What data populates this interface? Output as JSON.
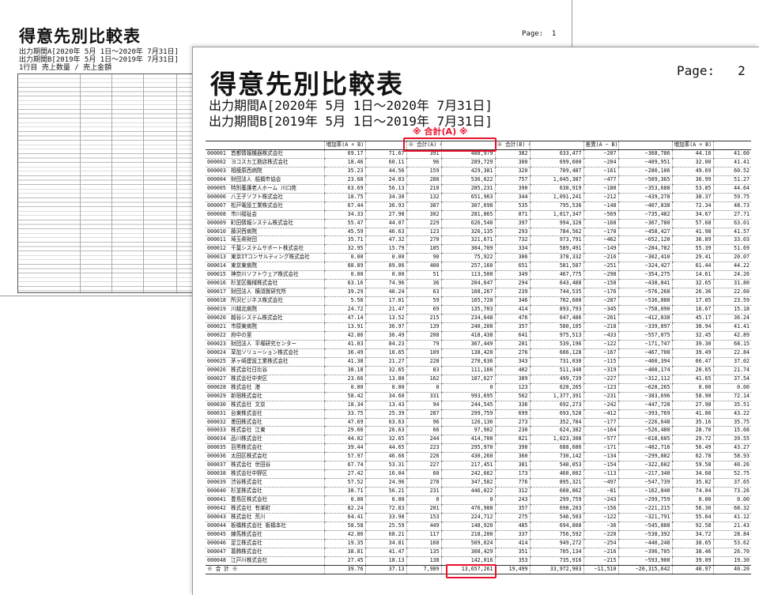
{
  "accent_color": "#e8102a",
  "page1": {
    "title": "得意先別比較表",
    "period_a": "出力期間A[2020年 5月 1日～2020年 7月31日]",
    "period_b": "出力期間B[2019年 5月 1日～2019年 7月31日]",
    "row_desc": "1行目 売上数量 / 売上金額",
    "page_label": "Page:  1"
  },
  "page2": {
    "title": "得意先別比較表",
    "page_label": "Page:   2",
    "period_a": "出力期間A[2020年 5月 1日～2020年 7月31日]",
    "period_b": "出力期間B[2019年 5月 1日～2019年 7月31日]",
    "annotation": "※ 合計(A) ※",
    "headers": [
      "",
      "増加率(A ÷ B)",
      "",
      "※ 合計(A) ※",
      "",
      "※ 合計(B) ※",
      "",
      "差異(A − B)",
      "",
      "増加率(A ÷ B)",
      ""
    ],
    "rows": [
      [
        "000001",
        "首都情報機器株式会社",
        "69.17",
        "71.67",
        "391",
        "488,979",
        "382",
        "633,477",
        "−207",
        "−368,786",
        "44.16",
        "41.60"
      ],
      [
        "000002",
        "ヨコスカ工務店株式会社",
        "18.46",
        "60.11",
        "96",
        "289,729",
        "300",
        "699,600",
        "−204",
        "−409,951",
        "32.00",
        "41.41"
      ],
      [
        "000003",
        "相模原西病院",
        "35.23",
        "44.56",
        "159",
        "429,381",
        "320",
        "709,487",
        "−161",
        "−280,106",
        "49.69",
        "60.52"
      ],
      [
        "000004",
        "財団法人 船橋市協会",
        "23.68",
        "24.03",
        "280",
        "536,022",
        "757",
        "1,045,387",
        "−477",
        "−509,365",
        "36.99",
        "51.27"
      ],
      [
        "000005",
        "特別養護老人ホーム 川口苑",
        "63.69",
        "56.13",
        "210",
        "285,231",
        "390",
        "638,919",
        "−180",
        "−353,688",
        "53.85",
        "44.64"
      ],
      [
        "000006",
        "八王子ソフト株式会社",
        "18.75",
        "34.30",
        "132",
        "651,963",
        "344",
        "1,091,241",
        "−212",
        "−439,278",
        "38.37",
        "59.75"
      ],
      [
        "000007",
        "松戸電設工業株式会社",
        "67.44",
        "36.93",
        "387",
        "307,698",
        "535",
        "795,536",
        "−148",
        "−407,838",
        "72.34",
        "48.73"
      ],
      [
        "000008",
        "市川福祉会",
        "34.33",
        "27.98",
        "302",
        "281,865",
        "871",
        "1,017,347",
        "−569",
        "−735,482",
        "34.67",
        "27.71"
      ],
      [
        "000009",
        "町田情報システム株式会社",
        "55.47",
        "44.07",
        "229",
        "626,540",
        "397",
        "994,320",
        "−168",
        "−367,780",
        "57.68",
        "63.01"
      ],
      [
        "000010",
        "藤沢西病院",
        "45.59",
        "46.63",
        "123",
        "326,135",
        "293",
        "784,562",
        "−170",
        "−458,427",
        "41.98",
        "41.57"
      ],
      [
        "000011",
        "埼玉県財団",
        "35.71",
        "47.32",
        "270",
        "321,671",
        "732",
        "973,791",
        "−462",
        "−652,120",
        "36.89",
        "33.03"
      ],
      [
        "000012",
        "千葉システムサポート株式会社",
        "32.95",
        "15.79",
        "185",
        "304,709",
        "334",
        "589,491",
        "−149",
        "−284,782",
        "55.39",
        "51.69"
      ],
      [
        "000013",
        "東京ITコンサルティング株式会社",
        "0.00",
        "0.00",
        "90",
        "75,922",
        "306",
        "378,332",
        "−216",
        "−302,410",
        "29.41",
        "20.07"
      ],
      [
        "000014",
        "東京東病院",
        "88.89",
        "89.06",
        "400",
        "257,160",
        "651",
        "581,587",
        "−251",
        "−324,427",
        "61.44",
        "44.22"
      ],
      [
        "000015",
        "神奈川ソフトウェア株式会社",
        "0.00",
        "0.00",
        "51",
        "113,500",
        "349",
        "467,775",
        "−298",
        "−354,275",
        "14.61",
        "24.26"
      ],
      [
        "000016",
        "杉並区機械株式会社",
        "63.16",
        "74.96",
        "36",
        "204,647",
        "294",
        "643,488",
        "−158",
        "−438,841",
        "32.65",
        "31.80"
      ],
      [
        "000017",
        "財団法人 横須賀研究所",
        "39.29",
        "40.24",
        "63",
        "168,267",
        "239",
        "744,535",
        "−176",
        "−576,268",
        "26.36",
        "22.60"
      ],
      [
        "000018",
        "所沢ビジネス株式会社",
        "5.56",
        "17.01",
        "59",
        "165,720",
        "346",
        "702,600",
        "−287",
        "−536,880",
        "17.05",
        "23.59"
      ],
      [
        "000019",
        "川越北病院",
        "24.72",
        "21.47",
        "69",
        "135,703",
        "414",
        "893,793",
        "−345",
        "−758,090",
        "16.67",
        "15.18"
      ],
      [
        "000020",
        "越谷システム株式会社",
        "47.14",
        "13.52",
        "215",
        "234,648",
        "476",
        "647,486",
        "−261",
        "−412,838",
        "45.17",
        "36.24"
      ],
      [
        "000021",
        "市原東病院",
        "13.91",
        "36.97",
        "139",
        "240,208",
        "357",
        "580,105",
        "−218",
        "−339,897",
        "38.94",
        "41.41"
      ],
      [
        "000022",
        "府中の里",
        "42.86",
        "36.49",
        "208",
        "418,438",
        "641",
        "975,513",
        "−433",
        "−557,075",
        "32.45",
        "42.89"
      ],
      [
        "000023",
        "財団法人 平塚研究センター",
        "41.03",
        "84.23",
        "79",
        "367,449",
        "201",
        "539,196",
        "−122",
        "−171,747",
        "39.30",
        "68.15"
      ],
      [
        "000024",
        "草加ソリューション株式会社",
        "36.49",
        "10.65",
        "109",
        "138,420",
        "276",
        "606,128",
        "−167",
        "−467,708",
        "39.49",
        "22.84"
      ],
      [
        "000025",
        "茅ヶ崎建設工業株式会社",
        "41.38",
        "21.27",
        "228",
        "270,636",
        "343",
        "731,030",
        "−115",
        "−460,394",
        "66.47",
        "37.02"
      ],
      [
        "000026",
        "株式会社日比谷",
        "38.18",
        "32.65",
        "83",
        "111,166",
        "402",
        "511,340",
        "−319",
        "−400,174",
        "20.65",
        "21.74"
      ],
      [
        "000027",
        "株式会社中央区",
        "23.66",
        "13.80",
        "162",
        "187,627",
        "389",
        "499,739",
        "−227",
        "−312,112",
        "41.65",
        "37.54"
      ],
      [
        "000028",
        "株式会社 港",
        "0.00",
        "0.00",
        "0",
        "0",
        "123",
        "628,265",
        "−123",
        "−628,265",
        "0.00",
        "0.00"
      ],
      [
        "000029",
        "新宿株式会社",
        "58.42",
        "34.60",
        "331",
        "993,695",
        "562",
        "1,377,391",
        "−231",
        "−383,696",
        "58.90",
        "72.14"
      ],
      [
        "000030",
        "株式会社 文京",
        "18.34",
        "13.43",
        "94",
        "244,545",
        "336",
        "692,273",
        "−242",
        "−447,728",
        "27.98",
        "35.51"
      ],
      [
        "000031",
        "台東株式会社",
        "33.75",
        "25.39",
        "287",
        "299,759",
        "699",
        "693,528",
        "−412",
        "−393,769",
        "41.06",
        "43.22"
      ],
      [
        "000032",
        "墨田株式会社",
        "47.69",
        "63.63",
        "96",
        "126,136",
        "273",
        "352,784",
        "−177",
        "−226,648",
        "35.16",
        "35.75"
      ],
      [
        "000033",
        "株式会社 江東",
        "29.66",
        "26.63",
        "66",
        "97,902",
        "230",
        "624,382",
        "−164",
        "−526,480",
        "28.70",
        "15.68"
      ],
      [
        "000034",
        "品川株式会社",
        "44.02",
        "32.65",
        "244",
        "414,700",
        "821",
        "1,023,308",
        "−577",
        "−618,605",
        "29.72",
        "39.55"
      ],
      [
        "000035",
        "目黒株式会社",
        "39.44",
        "44.65",
        "223",
        "295,970",
        "390",
        "688,686",
        "−171",
        "−402,716",
        "56.49",
        "43.27"
      ],
      [
        "000036",
        "太田区株式会社",
        "57.97",
        "46.66",
        "226",
        "430,260",
        "360",
        "730,142",
        "−134",
        "−299,882",
        "62.78",
        "58.93"
      ],
      [
        "000037",
        "株式会社 世田谷",
        "67.74",
        "53.31",
        "227",
        "217,451",
        "381",
        "540,053",
        "−154",
        "−322,602",
        "59.58",
        "40.26"
      ],
      [
        "000038",
        "株式会社中野区",
        "27.42",
        "16.04",
        "60",
        "242,662",
        "173",
        "460,002",
        "−113",
        "−217,340",
        "34.68",
        "52.75"
      ],
      [
        "000039",
        "渋谷株式会社",
        "57.52",
        "24.96",
        "278",
        "347,582",
        "776",
        "895,321",
        "−497",
        "−547,739",
        "35.82",
        "37.65"
      ],
      [
        "000040",
        "杉並株式会社",
        "38.71",
        "56.21",
        "231",
        "446,022",
        "312",
        "608,862",
        "−81",
        "−162,840",
        "74.04",
        "73.26"
      ],
      [
        "000041",
        "豊島区株式会社",
        "0.00",
        "0.00",
        "0",
        "0",
        "243",
        "299,759",
        "−243",
        "−299,759",
        "0.00",
        "0.00"
      ],
      [
        "000042",
        "株式会社 有楽町",
        "82.24",
        "72.83",
        "201",
        "476,988",
        "357",
        "698,203",
        "−156",
        "−221,215",
        "56.30",
        "68.32"
      ],
      [
        "000043",
        "株式会社 荒川",
        "64.41",
        "33.98",
        "153",
        "224,712",
        "275",
        "546,503",
        "−122",
        "−321,791",
        "55.64",
        "41.12"
      ],
      [
        "000044",
        "板橋株式会社 板橋本社",
        "58.58",
        "25.59",
        "449",
        "148,920",
        "485",
        "694,808",
        "−36",
        "−545,888",
        "92.58",
        "21.43"
      ],
      [
        "000045",
        "練馬株式会社",
        "42.86",
        "68.21",
        "117",
        "218,200",
        "337",
        "756,592",
        "−220",
        "−538,392",
        "34.72",
        "28.84"
      ],
      [
        "000046",
        "足立株式会社",
        "19.35",
        "34.81",
        "160",
        "509,024",
        "414",
        "949,272",
        "−254",
        "−440,248",
        "38.65",
        "53.62"
      ],
      [
        "000047",
        "葛飾株式会社",
        "38.81",
        "41.47",
        "135",
        "308,429",
        "351",
        "705,134",
        "−216",
        "−396,705",
        "38.46",
        "26.70"
      ],
      [
        "000048",
        "江戸川株式会社",
        "27.45",
        "18.13",
        "138",
        "142,016",
        "353",
        "735,916",
        "−215",
        "−593,900",
        "39.09",
        "19.30"
      ]
    ],
    "total": [
      "※ 合 計 ※",
      "",
      "39.76",
      "37.13",
      "7,989",
      "13,657,261",
      "19,499",
      "33,972,903",
      "−11,510",
      "−20,315,642",
      "40.97",
      "40.20"
    ]
  }
}
